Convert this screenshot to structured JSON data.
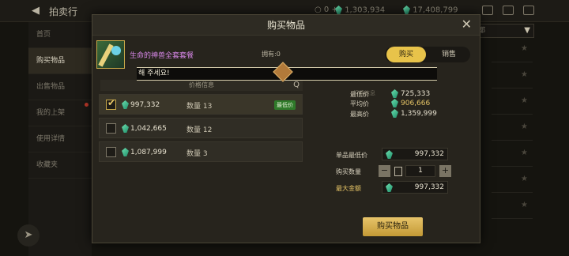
{
  "topbar": {
    "back_icon": "back-arrow-icon",
    "title": "拍卖行",
    "gold_value": "0",
    "gem_value": "1,303,934",
    "gem2_value": "17,408,799"
  },
  "sidebar": {
    "items": [
      {
        "label": "首页"
      },
      {
        "label": "购买物品"
      },
      {
        "label": "出售物品"
      },
      {
        "label": "我的上架"
      },
      {
        "label": "使用详情"
      },
      {
        "label": "收藏夹"
      }
    ]
  },
  "dropdown": {
    "label": "都"
  },
  "modal": {
    "title": "购买物品",
    "item_name": "生命的神兽全套套餐",
    "owned_label": "拥有:0",
    "tabs": [
      {
        "label": "购买"
      },
      {
        "label": "销售"
      }
    ],
    "tooltip": "해 주세요!",
    "list_header": "价格信息",
    "rows": [
      {
        "price": "997,332",
        "qty_label": "数量 13",
        "badge": "最低价",
        "selected": true
      },
      {
        "price": "1,042,665",
        "qty_label": "数量 12",
        "badge": "",
        "selected": false
      },
      {
        "price": "1,087,999",
        "qty_label": "数量 3",
        "badge": "",
        "selected": false
      }
    ],
    "info_header": "行情信息",
    "stats": {
      "low_label": "最低价",
      "low_value": "725,333",
      "avg_label": "平均价",
      "avg_value": "906,666",
      "high_label": "最高价",
      "high_value": "1,359,999"
    },
    "form": {
      "unit_label": "单品最低价",
      "unit_value": "997,332",
      "qty_label": "购买数量",
      "qty_value": "1",
      "max_label": "最大金额",
      "max_value": "997,332"
    },
    "buy_button": "购买物品"
  },
  "colors": {
    "accent": "#e8c34a",
    "item_name": "#d787e8",
    "badge_green": "#2f7a2a",
    "gem": "#3fc08e"
  }
}
